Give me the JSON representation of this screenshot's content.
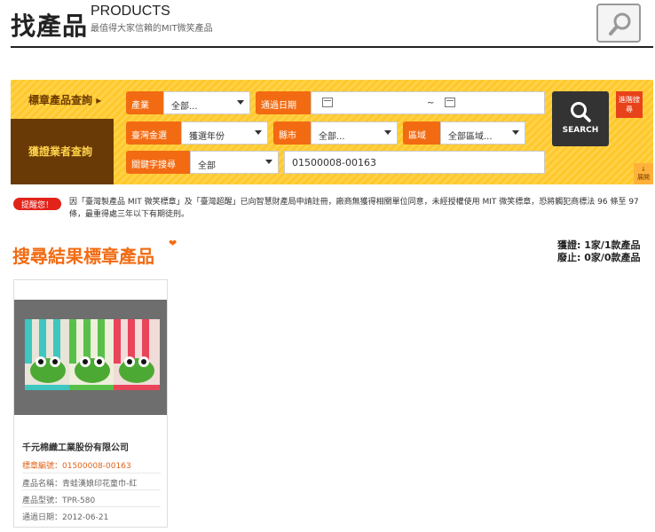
{
  "header": {
    "title": "找產品",
    "title_en": "PRODUCTS",
    "subtitle": "最值得大家信賴的MIT微笑產品"
  },
  "search_panel": {
    "tab_label_product": "標章產品查詢",
    "tab_label_company": "獲證業者查詢",
    "industry_label": "產業",
    "industry_value": "全部...",
    "date_label": "通過日期",
    "date_separator": "~",
    "award_label": "臺灣金選",
    "award_value": "獲選年份",
    "city_label": "縣市",
    "city_value": "全部...",
    "district_label": "區域",
    "district_value": "全部區域...",
    "keyword_label": "關鍵字搜尋",
    "keyword_scope_value": "全部",
    "keyword_value": "01500008-00163",
    "search_button": "SEARCH",
    "advanced_search": "進階搜尋",
    "expand": "展開"
  },
  "notice": {
    "badge": "提醒您！",
    "text": "因「臺灣製產品 MIT 微笑標章」及「臺灣超醒」已向智慧財產局申請註冊，廠商無獲得相關單位同意，未經授權使用 MIT 微笑標章，恐將觸犯商標法 96 條至 97 條，最重得處三年以下有期徒刑。"
  },
  "results": {
    "title": "搜尋結果標章產品",
    "stats_certified": "獲證: 1家/1款產品",
    "stats_revoked": "廢止: 0家/0款產品"
  },
  "products": [
    {
      "company": "千元棉織工業股份有限公司",
      "label_no": "標章編號：01500008-00163",
      "name": "產品名稱：青蛙漢娘印花童巾-紅",
      "model": "產品型號：TPR-580",
      "pass_date": "通過日期：2012-06-21"
    }
  ],
  "colors": {
    "accent": "#f26b12",
    "panel_yellow": "#ffc72a",
    "dark_brown": "#6a3a06"
  }
}
